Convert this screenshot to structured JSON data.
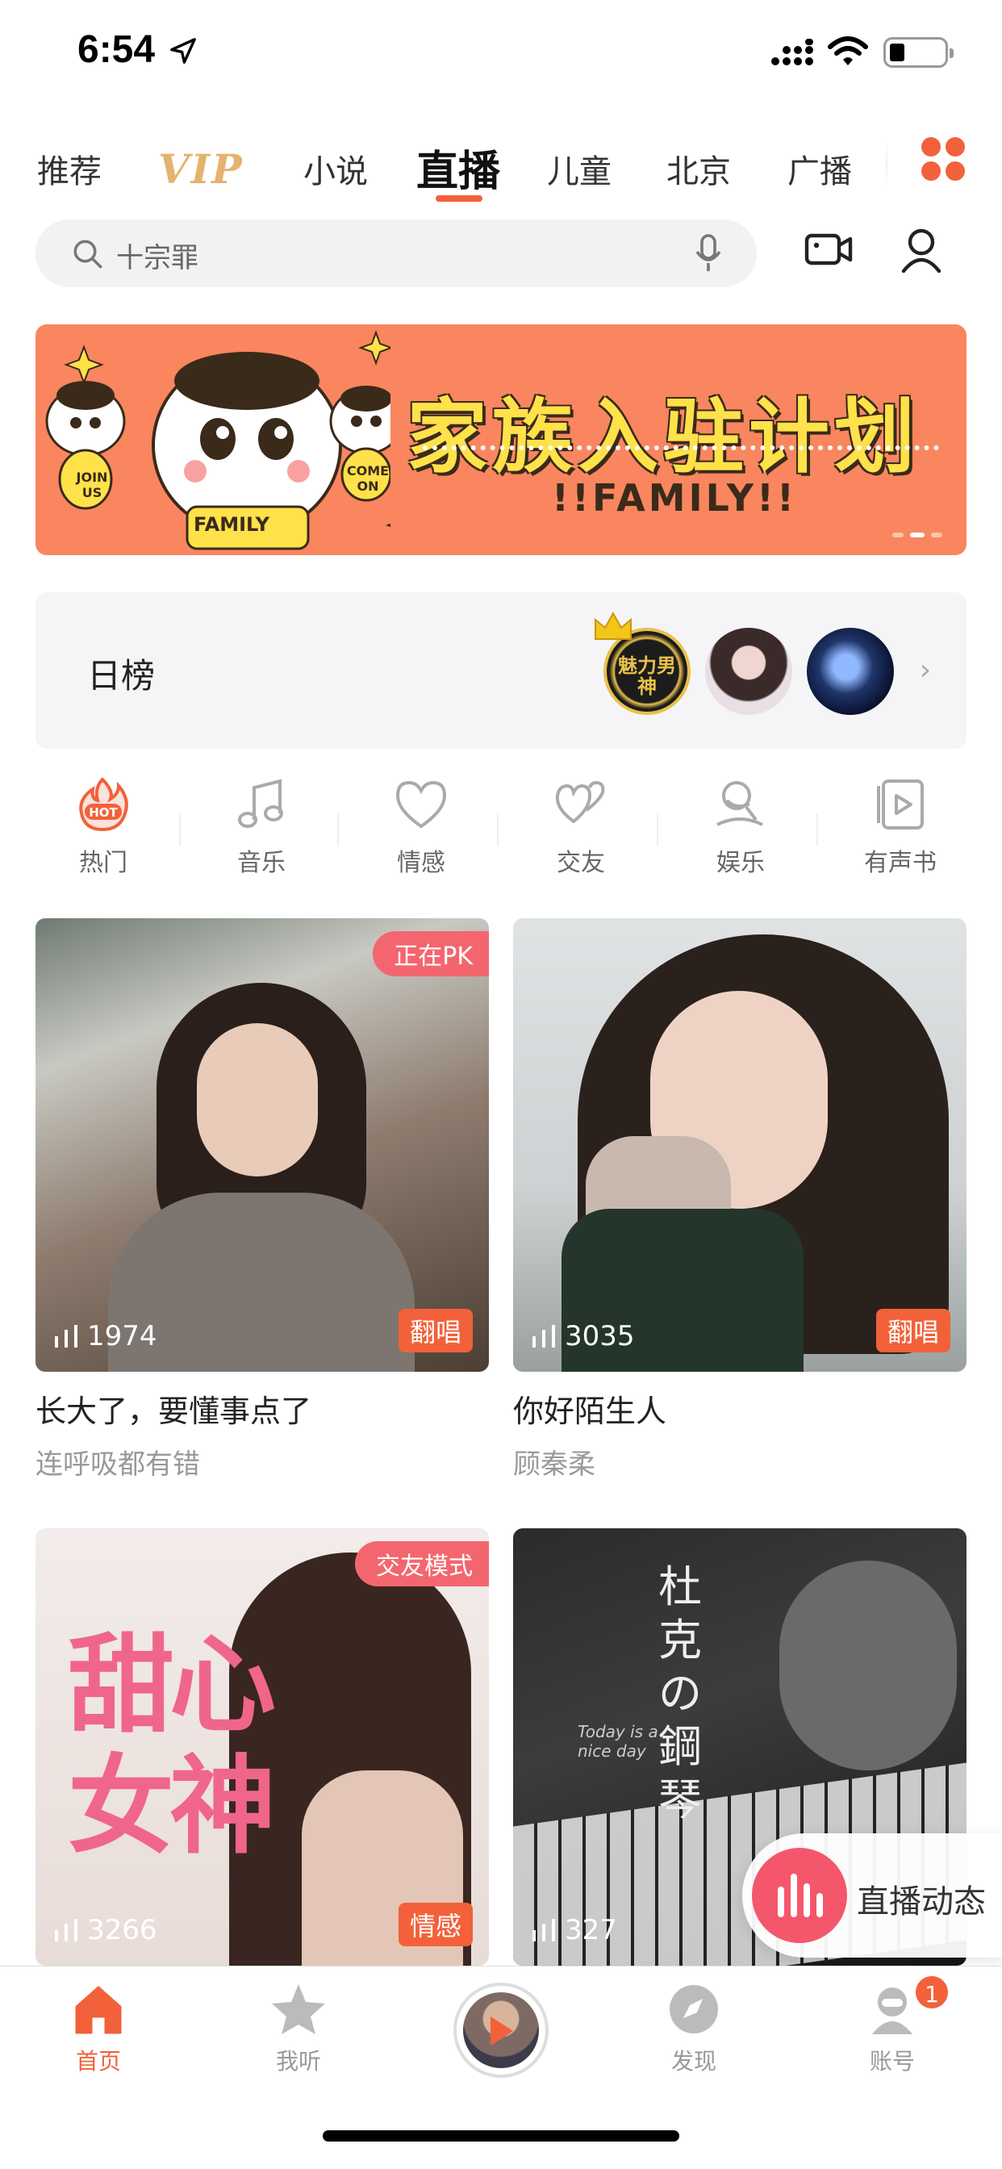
{
  "status_bar": {
    "time": "6:54"
  },
  "tabs": [
    {
      "label": "推荐"
    },
    {
      "label": "VIP"
    },
    {
      "label": "小说"
    },
    {
      "label": "直播"
    },
    {
      "label": "儿童"
    },
    {
      "label": "北京"
    },
    {
      "label": "广播"
    }
  ],
  "active_tab": "直播",
  "search": {
    "placeholder": "十宗罪"
  },
  "banner": {
    "title": "家族入驻计划",
    "subtitle": "!!FAMILY!!",
    "mascot_text": "FAMILY",
    "join_text": "JOIN US",
    "come_text": "COME ON"
  },
  "daily_rank": {
    "label": "日榜",
    "first_avatar_text": "魅力男神"
  },
  "categories": [
    {
      "label": "热门",
      "icon": "hot-icon",
      "badge": "HOT"
    },
    {
      "label": "音乐",
      "icon": "music-icon"
    },
    {
      "label": "情感",
      "icon": "heart-icon"
    },
    {
      "label": "交友",
      "icon": "friends-icon"
    },
    {
      "label": "娱乐",
      "icon": "entertainment-icon"
    },
    {
      "label": "有声书",
      "icon": "audiobook-icon"
    }
  ],
  "cards": [
    {
      "top_badge": "正在PK",
      "viewers": "1974",
      "tag": "翻唱",
      "title": "长大了，要懂事点了",
      "subtitle": "连呼吸都有错"
    },
    {
      "top_badge": "",
      "viewers": "3035",
      "tag": "翻唱",
      "title": "你好陌生人",
      "subtitle": "顾秦柔"
    },
    {
      "top_badge": "交友模式",
      "viewers": "3266",
      "tag": "情感",
      "title": "",
      "subtitle": "",
      "cover_text": "甜心女神"
    },
    {
      "top_badge": "",
      "viewers": "327",
      "tag": "",
      "title": "",
      "subtitle": "",
      "cover_text": "杜克の鋼琴",
      "cover_small": "Today is a nice day"
    }
  ],
  "live_dynamic": {
    "label": "直播动态"
  },
  "bottom_nav": [
    {
      "label": "首页",
      "icon": "home-icon",
      "active": true
    },
    {
      "label": "我听",
      "icon": "star-icon"
    },
    {
      "label": "发现",
      "icon": "compass-icon"
    },
    {
      "label": "账号",
      "icon": "account-icon",
      "badge": "1"
    }
  ],
  "colors": {
    "accent": "#f2613a",
    "pink": "#f4666f",
    "banner": "#f9865f"
  }
}
